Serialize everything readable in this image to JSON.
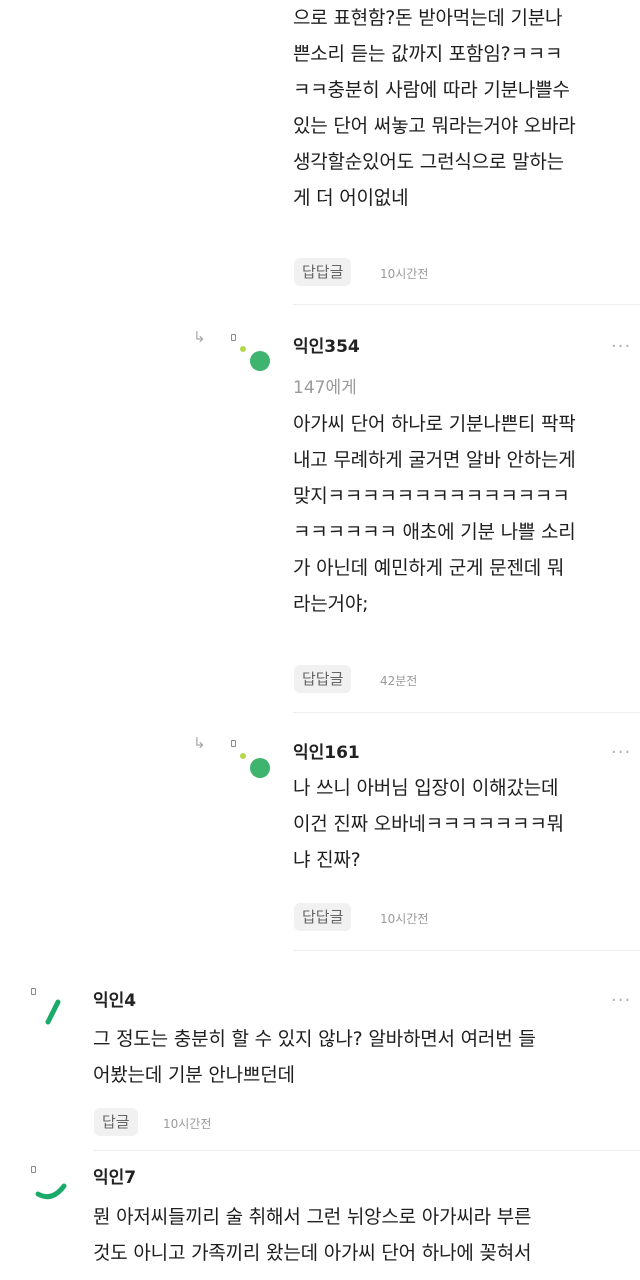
{
  "comments": [
    {
      "body_lines": [
        "으로 표현함?돈 받아먹는데 기분나",
        "쁜소리 듣는 값까지 포함임?ㅋㅋㅋ",
        "ㅋㅋ충분히 사람에 따라 기분나쁠수",
        "있는 단어 써놓고 뭐라는거야 오바라",
        "생각할순있어도 그런식으로 말하는",
        "게 더 어이없네"
      ],
      "reply_label": "답답글",
      "time": "10시간전"
    },
    {
      "nickname": "익인354",
      "to": "147에게",
      "body_lines": [
        "아가씨 단어 하나로 기분나쁜티 팍팍",
        "내고 무례하게 굴거면 알바 안하는게",
        "맞지ㅋㅋㅋㅋㅋㅋㅋㅋㅋㅋㅋㅋㅋㅋ",
        "ㅋㅋㅋㅋㅋㅋ 애초에 기분 나쁠 소리",
        "가 아닌데 예민하게 군게 문젠데 뭐",
        "라는거야;"
      ],
      "reply_label": "답답글",
      "time": "42분전"
    },
    {
      "nickname": "익인161",
      "body_lines": [
        "나 쓰니 아버님 입장이 이해갔는데",
        "이건 진짜 오바네ㅋㅋㅋㅋㅋㅋㅋ뭐",
        "냐 진짜?"
      ],
      "reply_label": "답답글",
      "time": "10시간전"
    },
    {
      "nickname": "익인4",
      "body_lines": [
        "그 정도는 충분히 할 수 있지 않나? 알바하면서 여러번 들",
        "어봤는데 기분 안나쁘던데"
      ],
      "reply_label": "답글",
      "time": "10시간전"
    },
    {
      "nickname": "익인7",
      "body_lines": [
        "뭔 아저씨들끼리 술 취해서 그런 뉘앙스로 아가씨라 부른",
        "것도 아니고 가족끼리 왔는데 아가씨 단어 하나에 꽂혀서"
      ]
    }
  ],
  "icons": {
    "reply_arrow": "reply-arrow-icon",
    "more": "more-options-icon",
    "small_square": "lock-icon",
    "avatar": "avatar-icon"
  },
  "more_glyph": "···",
  "reply_arrow_glyph": "↳",
  "colors": {
    "avatar_green": "#3fb46e",
    "avatar_lime": "#b4d84a",
    "avatar_teal": "#1aab6a",
    "button_bg": "#f1f1f1",
    "divider": "#eeeeee"
  }
}
